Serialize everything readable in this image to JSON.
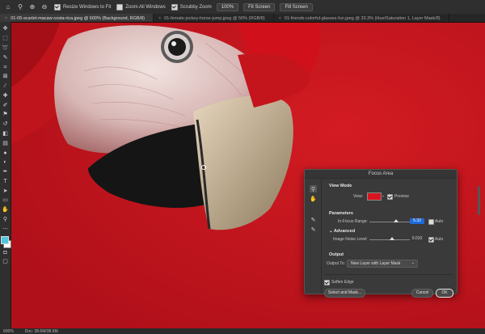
{
  "options_bar": {
    "resize_windows_label": "Resize Windows to Fit",
    "zoom_all_windows_label": "Zoom All Windows",
    "scrubby_zoom_label": "Scrubby Zoom",
    "zoom_100_label": "100%",
    "fit_screen_label": "Fit Screen",
    "fill_screen_label": "Fill Screen",
    "resize_windows_checked": true,
    "zoom_all_windows_checked": false,
    "scrubby_zoom_checked": true
  },
  "tabs": [
    {
      "label": "01-05-scarlet-macaw-costa-rica.jpeg @ 600% (Background, RGB/8)",
      "active": true
    },
    {
      "label": "01-female-jockey-horse-jump.jpeg @ 50% (RGB/8)",
      "active": false
    },
    {
      "label": "01-friends-colorful-glasses-fun.jpeg @ 33.3% (Hue/Saturation 1, Layer Mask/8)",
      "active": false
    }
  ],
  "status_bar": {
    "zoom": "600%",
    "doc_info": "Doc: 38.6M/38.6M"
  },
  "colors": {
    "foreground": "#4fc6df",
    "background": "#ffffff",
    "view_overlay": "#d8141f",
    "selection_blue": "#1f69d6"
  },
  "focus_area": {
    "title": "Focus Area",
    "view_mode_heading": "View Mode",
    "view_label": "View:",
    "preview_label": "Preview",
    "preview_checked": true,
    "parameters_heading": "Parameters",
    "in_focus_range_label": "In-Focus Range:",
    "in_focus_range_value": "5.32",
    "in_focus_range_fraction": 0.66,
    "in_focus_auto_label": "Auto",
    "in_focus_auto_checked": false,
    "advanced_heading": "Advanced",
    "image_noise_label": "Image Noise Level:",
    "image_noise_value": "0.010",
    "image_noise_fraction": 0.55,
    "image_noise_auto_label": "Auto",
    "image_noise_auto_checked": true,
    "output_heading": "Output",
    "output_to_label": "Output To:",
    "output_to_value": "New Layer with Layer Mask",
    "soften_edge_label": "Soften Edge",
    "soften_edge_checked": true,
    "select_and_mask_label": "Select and Mask...",
    "cancel_label": "Cancel",
    "ok_label": "OK"
  }
}
